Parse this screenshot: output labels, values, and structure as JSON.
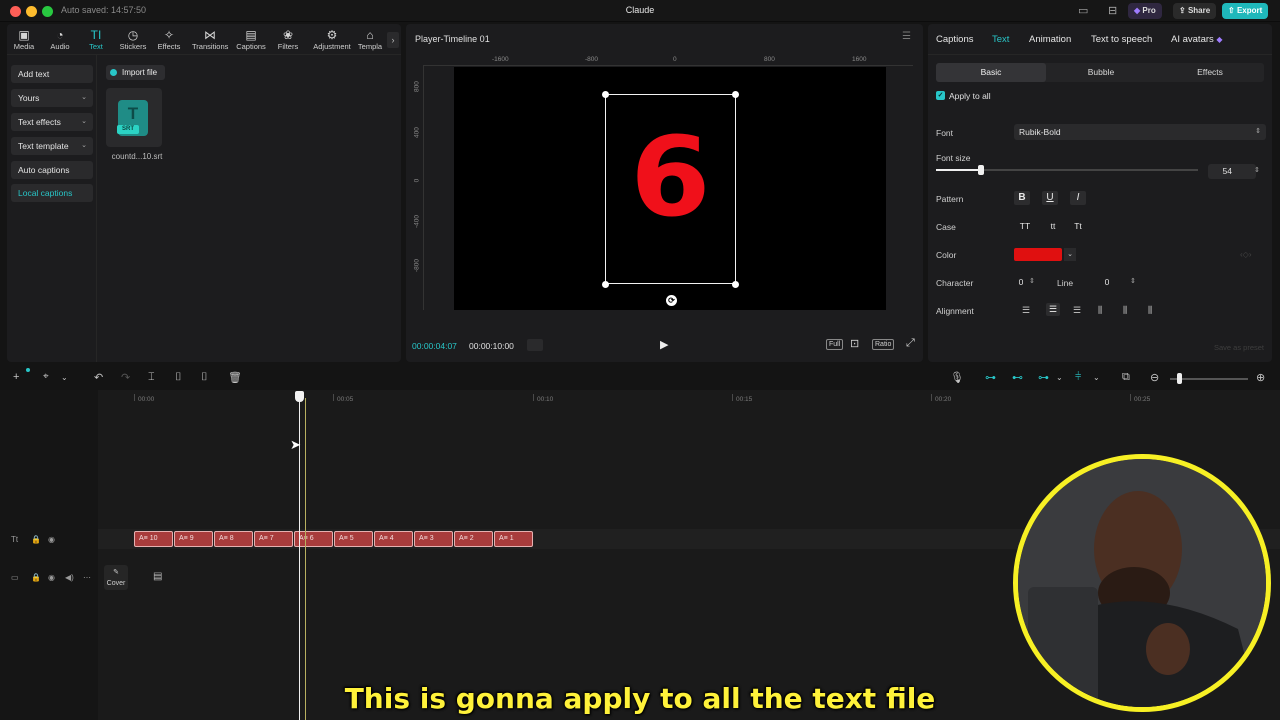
{
  "app": {
    "title": "Claude",
    "autosaved": "Auto saved: 14:57:50",
    "pro_label": "Pro",
    "share_label": "Share",
    "export_label": "Export"
  },
  "toolbar": {
    "items": [
      "Media",
      "Audio",
      "Text",
      "Stickers",
      "Effects",
      "Transitions",
      "Captions",
      "Filters",
      "Adjustment",
      "Templa"
    ],
    "active": "Text"
  },
  "sidebar": {
    "items": [
      {
        "label": "Add text"
      },
      {
        "label": "Yours"
      },
      {
        "label": "Text effects"
      },
      {
        "label": "Text template"
      },
      {
        "label": "Auto captions"
      },
      {
        "label": "Local captions"
      }
    ]
  },
  "library": {
    "import_label": "Import file",
    "file_name": "countd...10.srt",
    "file_badge": "SRT",
    "file_glyph": "T"
  },
  "player": {
    "title": "Player-Timeline 01",
    "ruler_x": [
      "-1600",
      "-800",
      "0",
      "800",
      "1600"
    ],
    "ruler_y": [
      "800",
      "400",
      "0",
      "-400",
      "-800"
    ],
    "canvas_text": "6",
    "timecode_current": "00:00:04:07",
    "timecode_total": "00:00:10:00",
    "btn_full": "Full",
    "btn_ratio": "Ratio"
  },
  "inspector": {
    "tabs": [
      "Captions",
      "Text",
      "Animation",
      "Text to speech",
      "AI avatars"
    ],
    "active_tab": "Text",
    "subtabs": [
      "Basic",
      "Bubble",
      "Effects"
    ],
    "active_subtab": "Basic",
    "apply_all": "Apply to all",
    "font_label": "Font",
    "font_value": "Rubik-Bold",
    "fontsize_label": "Font size",
    "fontsize_value": "54",
    "fontsize_fraction": 0.17,
    "pattern_label": "Pattern",
    "pattern_buttons": [
      "B",
      "U",
      "I"
    ],
    "case_label": "Case",
    "case_buttons": [
      "TT",
      "tt",
      "Tt"
    ],
    "color_label": "Color",
    "color_value": "#e01010",
    "character_label": "Character",
    "character_value": "0",
    "line_label": "Line",
    "line_value": "0",
    "alignment_label": "Alignment",
    "save_preset": "Save as preset"
  },
  "timeline": {
    "ticks": [
      "00:00",
      "00:05",
      "00:10",
      "00:15",
      "00:20",
      "00:25"
    ],
    "clips": [
      "10",
      "9",
      "8",
      "7",
      "6",
      "5",
      "4",
      "3",
      "2",
      "1"
    ],
    "clip_prefix": "A≡",
    "cover_label": "Cover",
    "zoom_fraction": 0.12
  },
  "subtitle": "This is gonna apply to all the text file"
}
